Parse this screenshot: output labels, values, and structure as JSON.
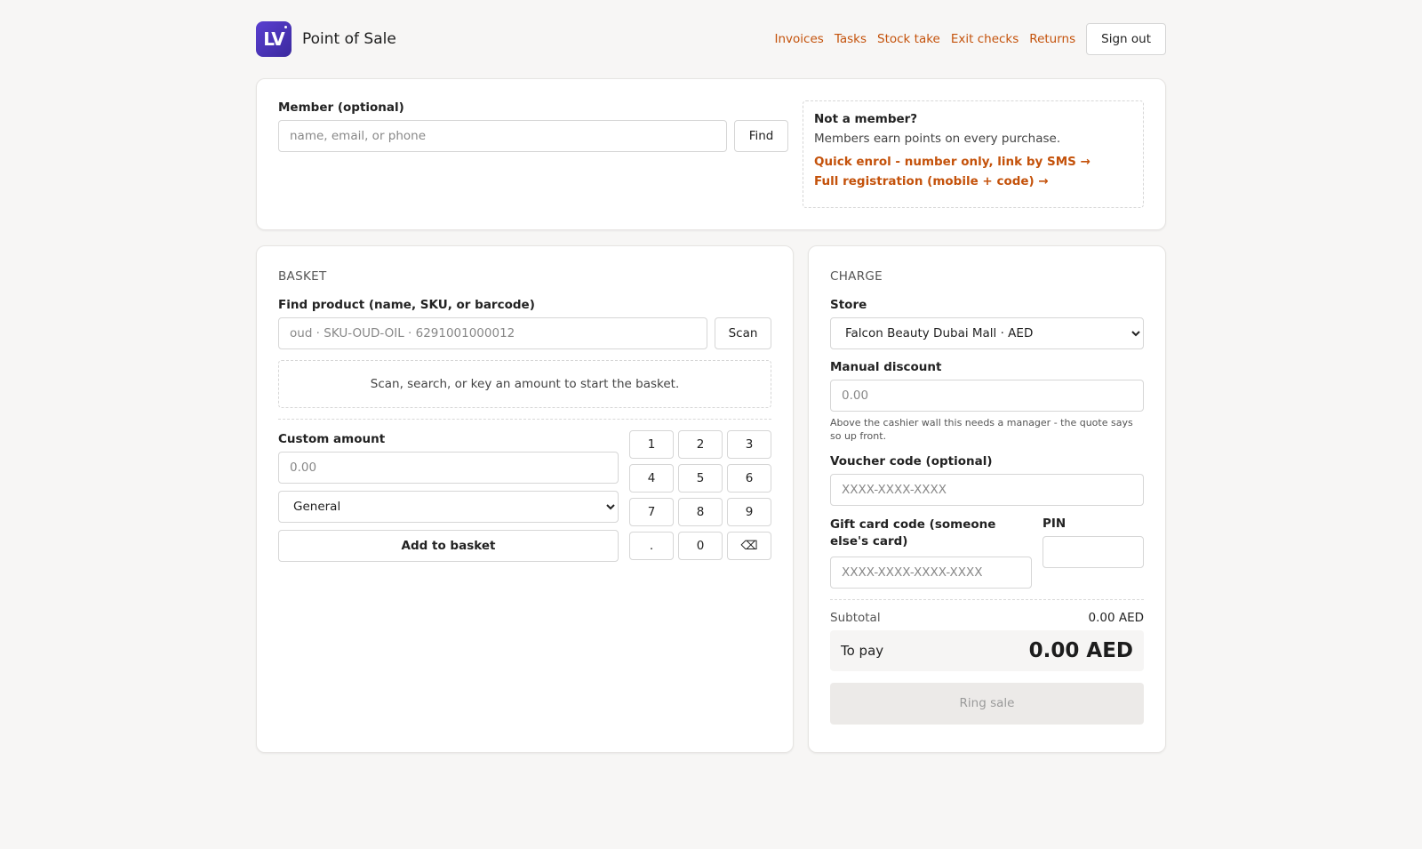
{
  "header": {
    "logo_text": "LV",
    "title": "Point of Sale",
    "nav": [
      "Invoices",
      "Tasks",
      "Stock take",
      "Exit checks",
      "Returns"
    ],
    "sign_out": "Sign out"
  },
  "member": {
    "label": "Member (optional)",
    "placeholder": "name, email, or phone",
    "find": "Find",
    "not_member": {
      "title": "Not a member?",
      "subtitle": "Members earn points on every purchase.",
      "quick_enrol": "Quick enrol - number only, link by SMS →",
      "full_registration": "Full registration (mobile + code) →"
    }
  },
  "basket": {
    "title": "BASKET",
    "find_label": "Find product (name, SKU, or barcode)",
    "find_placeholder": "oud · SKU-OUD-OIL · 6291001000012",
    "scan": "Scan",
    "empty": "Scan, search, or key an amount to start the basket.",
    "custom_label": "Custom amount",
    "custom_placeholder": "0.00",
    "category_selected": "General",
    "add": "Add to basket",
    "keys": [
      "1",
      "2",
      "3",
      "4",
      "5",
      "6",
      "7",
      "8",
      "9",
      ".",
      "0",
      "⌫"
    ]
  },
  "charge": {
    "title": "CHARGE",
    "store_label": "Store",
    "store_selected": "Falcon Beauty Dubai Mall · AED",
    "discount_label": "Manual discount",
    "discount_placeholder": "0.00",
    "discount_hint": "Above the cashier wall this needs a manager - the quote says so up front.",
    "voucher_label": "Voucher code (optional)",
    "voucher_placeholder": "XXXX-XXXX-XXXX",
    "gift_label": "Gift card code (someone else's card)",
    "gift_placeholder": "XXXX-XXXX-XXXX-XXXX",
    "pin_label": "PIN",
    "subtotal_label": "Subtotal",
    "subtotal_value": "0.00 AED",
    "topay_label": "To pay",
    "topay_value": "0.00 AED",
    "ring": "Ring sale"
  }
}
